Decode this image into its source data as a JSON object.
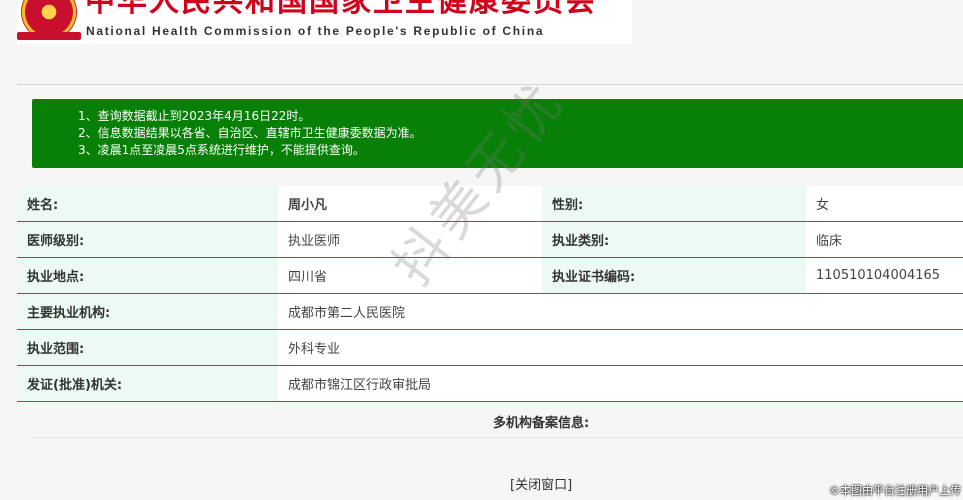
{
  "header": {
    "title_cn": "中华人民共和国国家卫生健康委员会",
    "title_en": "National Health Commission of the People's Republic of China",
    "emblem_icon": "national-emblem-icon"
  },
  "notice": {
    "background_color": "#088008",
    "items": [
      "1、查询数据截止到2023年4月16日22时。",
      "2、信息数据结果以各省、自治区、直辖市卫生健康委数据为准。",
      "3、凌晨1点至凌晨5点系统进行维护，不能提供查询。"
    ]
  },
  "record": {
    "name_label": "姓名:",
    "name_value": "周小凡",
    "gender_label": "性别:",
    "gender_value": "女",
    "level_label": "医师级别:",
    "level_value": "执业医师",
    "category_label": "执业类别:",
    "category_value": "临床",
    "location_label": "执业地点:",
    "location_value": "四川省",
    "cert_label": "执业证书编码:",
    "cert_value": "110510104004165",
    "org_label": "主要执业机构:",
    "org_value": "成都市第二人民医院",
    "scope_label": "执业范围:",
    "scope_value": "外科专业",
    "issuer_label": "发证(批准)机关:",
    "issuer_value": "成都市锦江区行政审批局"
  },
  "multi_org": {
    "title": "多机构备案信息:"
  },
  "actions": {
    "close_label": "[关闭窗口]"
  },
  "watermark": {
    "text": "抖美无忧"
  },
  "footer": {
    "text": "©本图由平台注册用户上传"
  }
}
